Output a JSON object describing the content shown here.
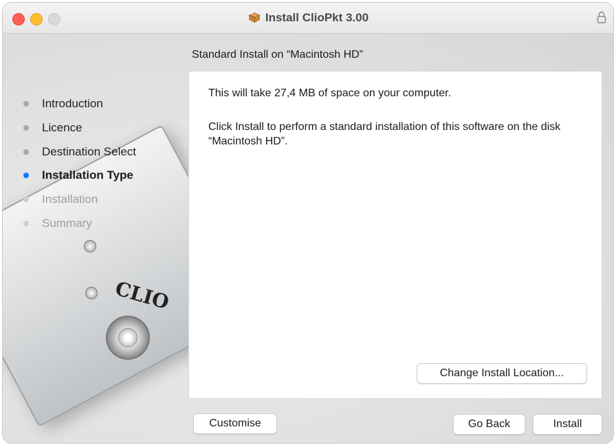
{
  "window": {
    "title": "Install ClioPkt 3.00",
    "accent_color": "#1677ff"
  },
  "sidebar": {
    "steps": [
      {
        "label": "Introduction",
        "state": "done"
      },
      {
        "label": "Licence",
        "state": "done"
      },
      {
        "label": "Destination Select",
        "state": "done"
      },
      {
        "label": "Installation Type",
        "state": "active"
      },
      {
        "label": "Installation",
        "state": "future"
      },
      {
        "label": "Summary",
        "state": "future"
      }
    ]
  },
  "background": {
    "device_brand": "CLIO"
  },
  "main": {
    "heading": "Standard Install on “Macintosh HD”",
    "space_text": "This will take 27,4 MB of space on your computer.",
    "install_text": "Click Install to perform a standard installation of this software on the disk “Macintosh HD”.",
    "change_location_label": "Change Install Location..."
  },
  "footer": {
    "customise_label": "Customise",
    "go_back_label": "Go Back",
    "install_label": "Install"
  }
}
